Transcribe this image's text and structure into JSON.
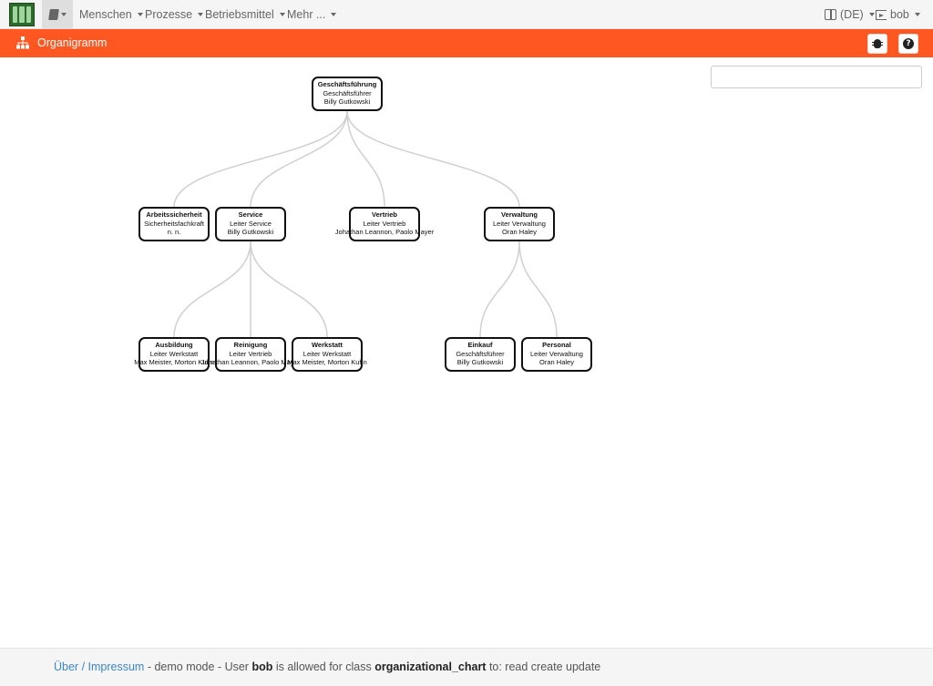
{
  "nav": {
    "menus": [
      "Menschen",
      "Prozesse",
      "Betriebsmittel",
      "Mehr ..."
    ],
    "language": "(DE)",
    "user": "bob"
  },
  "titlebar": {
    "title": "Organigramm"
  },
  "search": {
    "value": "",
    "placeholder": ""
  },
  "org": {
    "root": {
      "title": "Geschäftsführung",
      "role": "Geschäftsführer",
      "person": "Billy Gutkowski"
    },
    "level1": [
      {
        "title": "Arbeitssicherheit",
        "role": "Sicherheitsfachkraft",
        "person": "n. n."
      },
      {
        "title": "Service",
        "role": "Leiter Service",
        "person": "Billy Gutkowski"
      },
      {
        "title": "Vertrieb",
        "role": "Leiter Vertrieb",
        "person": "Johathan Leannon, Paolo Mayer"
      },
      {
        "title": "Verwaltung",
        "role": "Leiter Verwaltung",
        "person": "Oran Haley"
      }
    ],
    "level2": [
      {
        "title": "Ausbildung",
        "role": "Leiter Werkstatt",
        "person": "Max Meister, Morton Kuhn"
      },
      {
        "title": "Reinigung",
        "role": "Leiter Vertrieb",
        "person": "Johathan Leannon, Paolo Mayer"
      },
      {
        "title": "Werkstatt",
        "role": "Leiter Werkstatt",
        "person": "Max Meister, Morton Kuhn"
      },
      {
        "title": "Einkauf",
        "role": "Geschäftsführer",
        "person": "Billy Gutkowski"
      },
      {
        "title": "Personal",
        "role": "Leiter Verwaltung",
        "person": "Oran Haley"
      }
    ]
  },
  "footer": {
    "link": "Über / Impressum",
    "text1": " - demo mode - User ",
    "user": "bob",
    "text2": " is allowed for class ",
    "class_name": "organizational_chart",
    "text3": " to: read create update"
  }
}
